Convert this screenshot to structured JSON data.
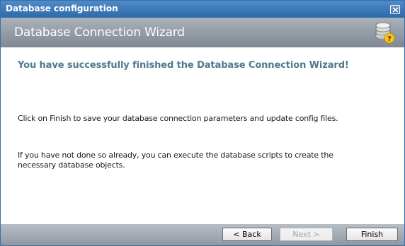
{
  "window": {
    "title": "Database configuration"
  },
  "header": {
    "title": "Database Connection Wizard",
    "icon": "database-help-icon"
  },
  "content": {
    "heading": "You have successfully finished the Database Connection Wizard!",
    "paragraph1": "Click on Finish to save your database connection parameters and update config files.",
    "paragraph2": "If you have not done so already, you can execute the database scripts to create the necessary database objects."
  },
  "buttons": {
    "back": "< Back",
    "next": "Next >",
    "finish": "Finish",
    "next_enabled": false
  },
  "colors": {
    "titlebar": "#3b75b4",
    "header": "#939ba5",
    "heading_text": "#4e7a8c"
  }
}
